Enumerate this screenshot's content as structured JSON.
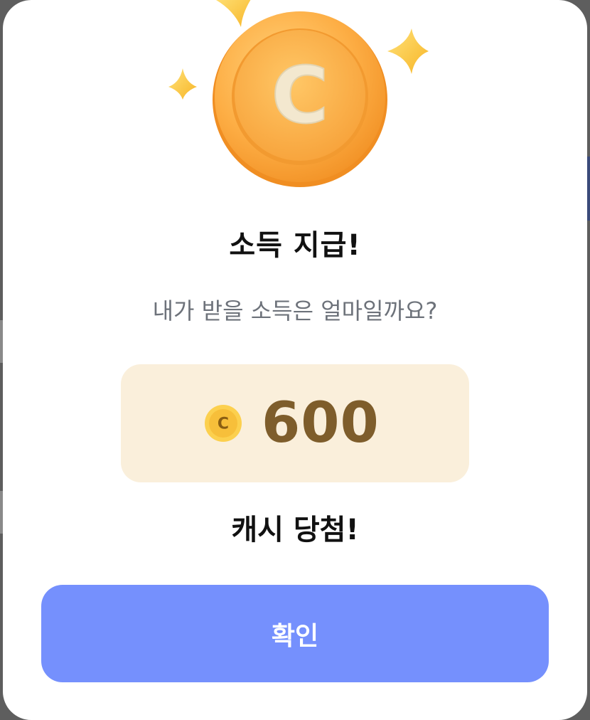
{
  "modal": {
    "title": "소득 지급!",
    "subtitle": "내가 받을 소득은 얼마일까요?",
    "reward": {
      "coin_symbol": "C",
      "amount": "600"
    },
    "result_text": "캐시 당첨!",
    "confirm_label": "확인"
  },
  "icons": {
    "hero": "coin-with-sparkles-icon",
    "amount": "cash-coin-icon"
  },
  "colors": {
    "title": "#111111",
    "subtitle": "#6d727a",
    "amount_box_bg": "#faefdb",
    "amount_text": "#7e5d2b",
    "coin_orange": "#fdb04a",
    "button": "#7590fd",
    "button_text": "#ffffff"
  }
}
